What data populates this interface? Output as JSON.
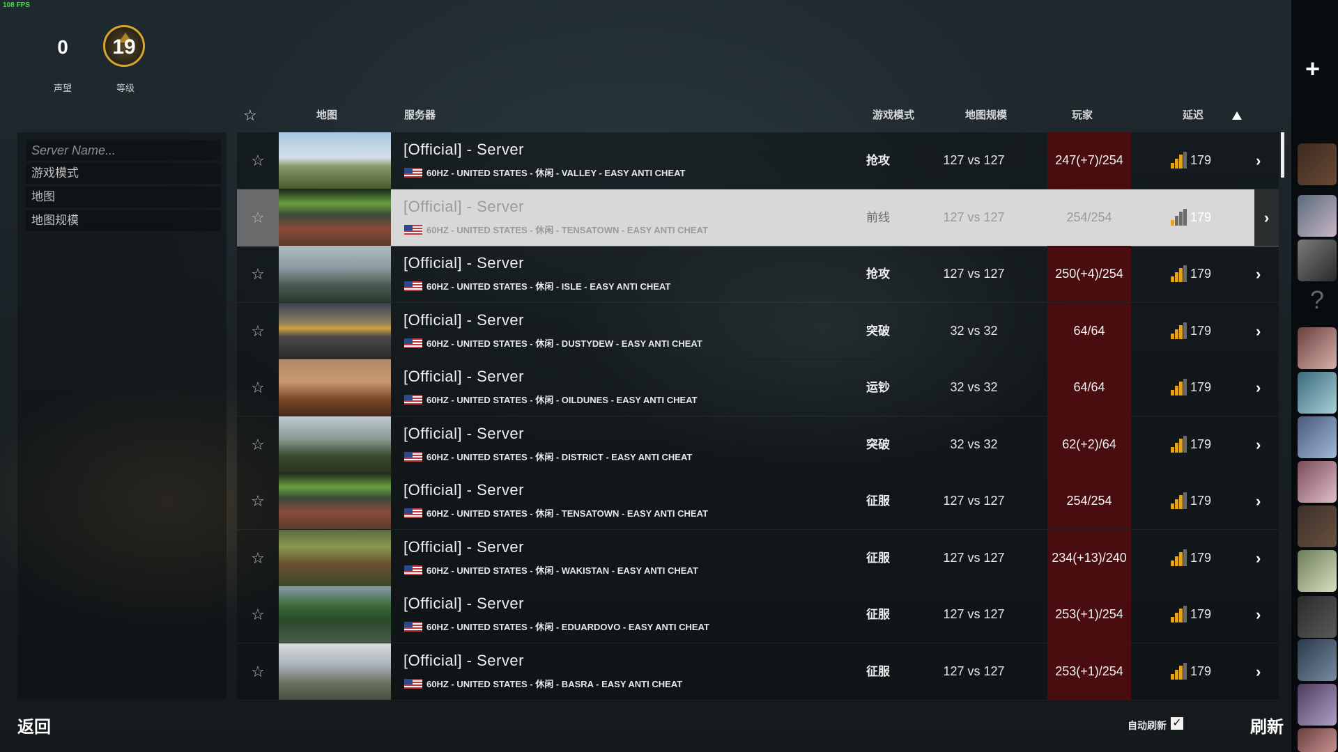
{
  "fps": "108 FPS",
  "stats": {
    "reputation_value": "0",
    "reputation_label": "声望",
    "level_value": "19",
    "level_label": "等级"
  },
  "filters": {
    "search_placeholder": "Server Name...",
    "game_mode": "游戏模式",
    "map": "地图",
    "map_size": "地图规模"
  },
  "columns": {
    "map": "地图",
    "server": "服务器",
    "game_mode": "游戏模式",
    "map_size": "地图规模",
    "players": "玩家",
    "ping": "延迟"
  },
  "rows": [
    {
      "title": "[Official] - Server",
      "meta": "60HZ - UNITED STATES - 休闲 - VALLEY - EASY ANTI CHEAT",
      "mode": "抢攻",
      "size": "127 vs 127",
      "players": "247(+7)/254",
      "ping": "179",
      "signal": 3,
      "thumb": "valley"
    },
    {
      "title": "[Official] - Server",
      "meta": "60HZ - UNITED STATES - 休闲 - TENSATOWN - EASY ANTI CHEAT",
      "mode": "前线",
      "size": "127 vs 127",
      "players": "254/254",
      "ping": "179",
      "signal": 1,
      "thumb": "tensatown",
      "selected": true
    },
    {
      "title": "[Official] - Server",
      "meta": "60HZ - UNITED STATES - 休闲 - ISLE - EASY ANTI CHEAT",
      "mode": "抢攻",
      "size": "127 vs 127",
      "players": "250(+4)/254",
      "ping": "179",
      "signal": 3,
      "thumb": "isle"
    },
    {
      "title": "[Official] - Server",
      "meta": "60HZ - UNITED STATES - 休闲 - DUSTYDEW - EASY ANTI CHEAT",
      "mode": "突破",
      "size": "32 vs 32",
      "players": "64/64",
      "ping": "179",
      "signal": 3,
      "thumb": "dustydew"
    },
    {
      "title": "[Official] - Server",
      "meta": "60HZ - UNITED STATES - 休闲 - OILDUNES - EASY ANTI CHEAT",
      "mode": "运钞",
      "size": "32 vs 32",
      "players": "64/64",
      "ping": "179",
      "signal": 3,
      "thumb": "oildunes"
    },
    {
      "title": "[Official] - Server",
      "meta": "60HZ - UNITED STATES - 休闲 - DISTRICT - EASY ANTI CHEAT",
      "mode": "突破",
      "size": "32 vs 32",
      "players": "62(+2)/64",
      "ping": "179",
      "signal": 3,
      "thumb": "district"
    },
    {
      "title": "[Official] - Server",
      "meta": "60HZ - UNITED STATES - 休闲 - TENSATOWN - EASY ANTI CHEAT",
      "mode": "征服",
      "size": "127 vs 127",
      "players": "254/254",
      "ping": "179",
      "signal": 3,
      "thumb": "tensatown"
    },
    {
      "title": "[Official] - Server",
      "meta": "60HZ - UNITED STATES - 休闲 - WAKISTAN - EASY ANTI CHEAT",
      "mode": "征服",
      "size": "127 vs 127",
      "players": "234(+13)/240",
      "ping": "179",
      "signal": 3,
      "thumb": "wakistan"
    },
    {
      "title": "[Official] - Server",
      "meta": "60HZ - UNITED STATES - 休闲 - EDUARDOVO - EASY ANTI CHEAT",
      "mode": "征服",
      "size": "127 vs 127",
      "players": "253(+1)/254",
      "ping": "179",
      "signal": 3,
      "thumb": "eduardovo"
    },
    {
      "title": "[Official] - Server",
      "meta": "60HZ - UNITED STATES - 休闲 - BASRA - EASY ANTI CHEAT",
      "mode": "征服",
      "size": "127 vs 127",
      "players": "253(+1)/254",
      "ping": "179",
      "signal": 3,
      "thumb": "basra"
    }
  ],
  "footer": {
    "back": "返回",
    "auto_refresh": "自动刷新",
    "auto_refresh_checked": true,
    "refresh": "刷新"
  },
  "colors": {
    "accent_gold": "#e0a51c",
    "full_server_red": "#4a0d0f",
    "selected_row": "#d8d8d8"
  }
}
